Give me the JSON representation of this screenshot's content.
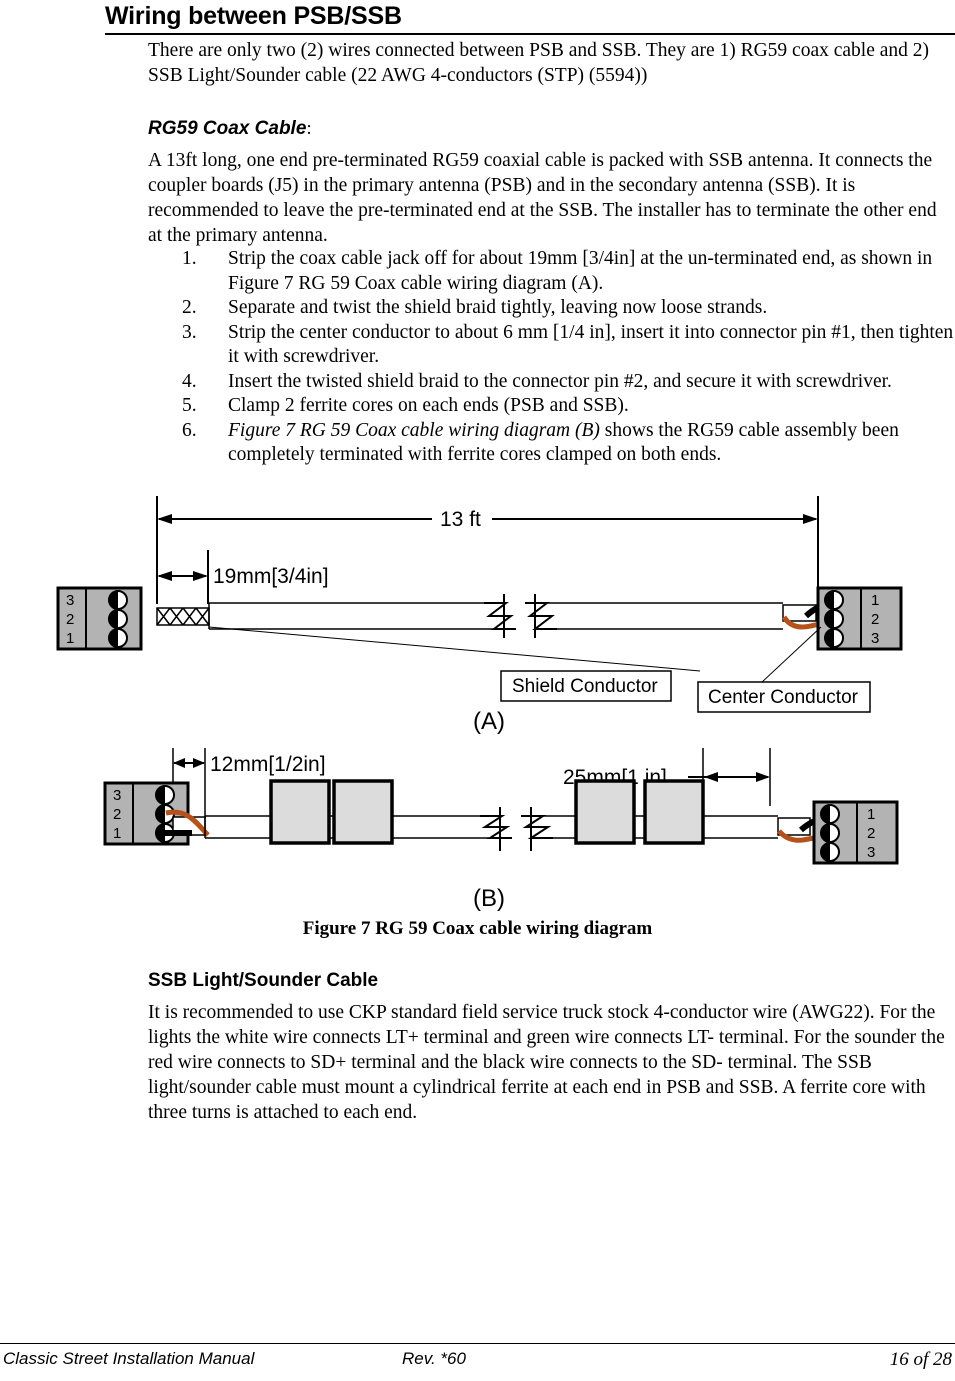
{
  "heading": "Wiring between PSB/SSB",
  "intro": "There are only two (2) wires connected between PSB and SSB. They are 1) RG59 coax cable and 2) SSB Light/Sounder cable (22 AWG 4-conductors (STP) (5594))",
  "coax_section": {
    "title": "RG59 Coax Cable",
    "title_suffix": ":",
    "body": "A 13ft long, one end pre-terminated RG59 coaxial cable is packed with SSB antenna. It connects the coupler boards (J5) in the primary antenna (PSB) and in the secondary antenna (SSB). It is recommended to leave the pre-terminated end at the SSB. The installer has to terminate the other end at the primary antenna.",
    "steps": [
      {
        "num": "1.",
        "text": "Strip the coax cable jack off for about 19mm [3/4in] at the un-terminated end, as shown in Figure 7 RG 59 Coax cable wiring diagram (A)."
      },
      {
        "num": "2.",
        "text": "Separate and twist the shield braid tightly, leaving now loose strands."
      },
      {
        "num": "3.",
        "text": "Strip the center conductor to about 6 mm [1/4 in], insert it into connector pin #1, then tighten it with screwdriver."
      },
      {
        "num": "4.",
        "text": "Insert the twisted shield braid to the connector pin #2, and secure it with screwdriver."
      },
      {
        "num": "5.",
        "text": "Clamp 2 ferrite cores on each ends (PSB and SSB)."
      },
      {
        "num": "6.",
        "italic_lead": "Figure 7 RG 59 Coax cable wiring diagram (B)",
        "text": " shows the RG59 cable assembly been completely terminated with ferrite cores clamped on both ends."
      }
    ]
  },
  "figure": {
    "caption": "Figure 7 RG 59 Coax cable wiring diagram",
    "panel_a_label": "(A)",
    "panel_b_label": "(B)",
    "dim_total": "13 ft",
    "dim_strip": "19mm[3/4in]",
    "dim_12mm": "12mm[1/2in]",
    "dim_25mm": "25mm[1 in]",
    "callout_shield": "Shield Conductor",
    "callout_center": "Center Conductor",
    "connector_left_pins": [
      "3",
      "2",
      "1"
    ],
    "connector_right_pins": [
      "1",
      "2",
      "3"
    ],
    "colors": {
      "shield_wire": "#b5511a",
      "center_wire": "#000000",
      "connector_body": "#b3b3b3",
      "ferrite_core": "#dcdcdc",
      "jacket": "#ffffff"
    }
  },
  "sounder_section": {
    "title": "SSB Light/Sounder Cable",
    "body": "It is recommended to use CKP standard field service truck stock 4-conductor wire (AWG22). For the lights the white wire connects LT+ terminal and green wire connects LT- terminal. For the sounder the red wire connects to SD+ terminal and the black wire connects to the SD- terminal. The SSB light/sounder cable must mount a cylindrical ferrite at each end in PSB and SSB. A ferrite core with three turns is attached to each end."
  },
  "footer": {
    "left": "Classic Street Installation Manual",
    "middle": "Rev. *60",
    "right": "16 of 28"
  }
}
